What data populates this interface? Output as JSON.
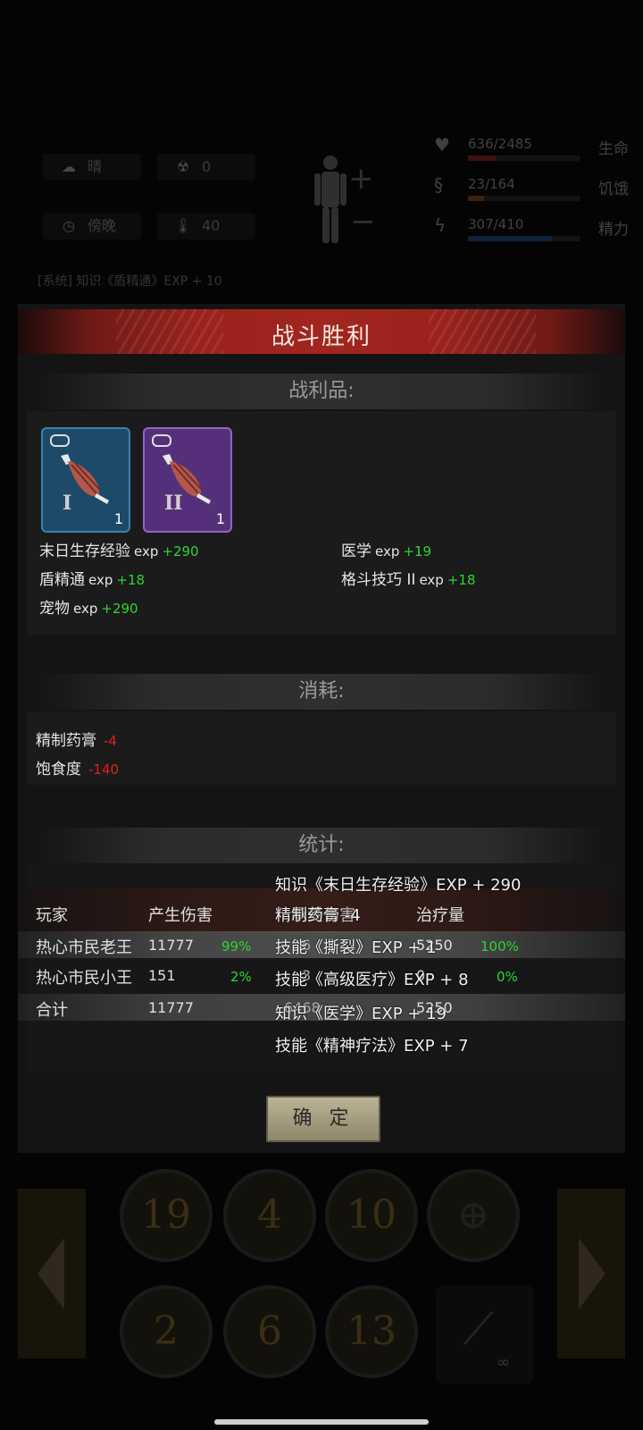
{
  "hud": {
    "weather": "晴",
    "radiation": "0",
    "time_of_day": "傍晚",
    "temperature": "40",
    "health": {
      "value": "636/2485",
      "label": "生命",
      "fraction": 0.256,
      "color": "#b02a2a"
    },
    "hunger": {
      "value": "23/164",
      "label": "饥饿",
      "fraction": 0.14,
      "color": "#a85a20"
    },
    "energy": {
      "value": "307/410",
      "label": "精力",
      "fraction": 0.75,
      "color": "#2a5fa8"
    },
    "log_line": "[系统] 知识《盾精通》EXP + 10"
  },
  "dialog": {
    "title": "战斗胜利",
    "loot": {
      "header": "战利品:",
      "items": [
        {
          "tier": "I",
          "qty": "1",
          "rarity_color": "#1e4a6a"
        },
        {
          "tier": "II",
          "qty": "1",
          "rarity_color": "#55307a"
        }
      ],
      "exp": [
        {
          "name": "末日生存经验",
          "unit": "exp",
          "gain": "+290"
        },
        {
          "name": "医学",
          "unit": "exp",
          "gain": "+19"
        },
        {
          "name": "盾精通",
          "unit": "exp",
          "gain": "+18"
        },
        {
          "name": "格斗技巧 II",
          "unit": "exp",
          "gain": "+18"
        },
        {
          "name": "宠物",
          "unit": "exp",
          "gain": "+290"
        }
      ]
    },
    "consumption": {
      "header": "消耗:",
      "items": [
        {
          "name": "精制药膏",
          "amount": "-4"
        },
        {
          "name": "饱食度",
          "amount": "-140"
        }
      ]
    },
    "stats": {
      "header": "统计:",
      "columns": [
        "玩家",
        "产生伤害",
        "承受伤害",
        "治疗量"
      ],
      "rows": [
        {
          "player": "热心市民老王",
          "damage": "11777",
          "damage_pct": "99%",
          "taken": "6",
          "heal": "5250",
          "heal_pct": "100%"
        },
        {
          "player": "热心市民小王",
          "damage": "151",
          "damage_pct": "2%",
          "taken": "3",
          "heal": "0",
          "heal_pct": "0%"
        }
      ],
      "total": {
        "label": "合计",
        "damage": "11777",
        "taken": "6468",
        "heal": "5250"
      }
    },
    "popup": [
      "知识《末日生存经验》EXP + 290",
      "精制药膏 -4",
      "技能《撕裂》EXP + 1",
      "技能《高级医疗》EXP + 8",
      "知识《医学》EXP + 19",
      "技能《精神疗法》EXP + 7"
    ],
    "confirm_label": "确 定"
  },
  "skills": [
    "19",
    "4",
    "10",
    "2",
    "6",
    "13"
  ],
  "infinity": "∞"
}
